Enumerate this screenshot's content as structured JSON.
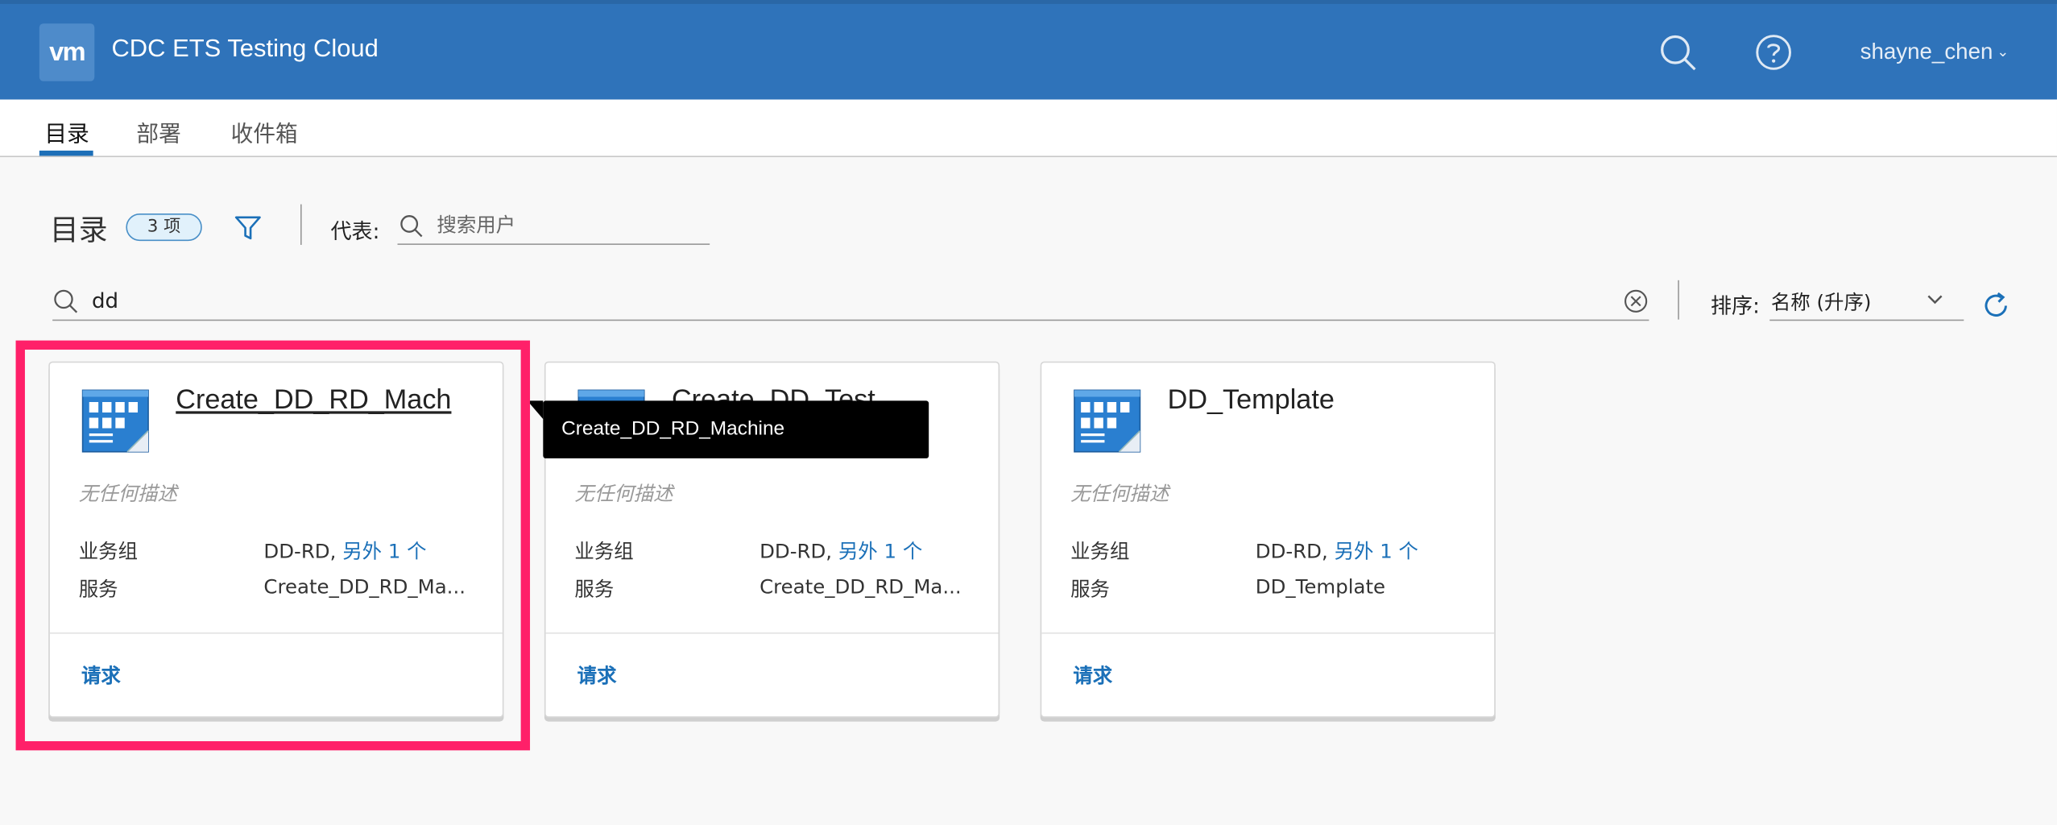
{
  "app": {
    "logo_text": "vm",
    "title": "CDC ETS Testing Cloud",
    "user": "shayne_chen",
    "brand_color": "#2f73ba",
    "accent_color": "#1b70b8",
    "highlight_color": "#ff2069"
  },
  "header_icons": [
    "search-icon",
    "help-icon"
  ],
  "nav": {
    "tabs": [
      {
        "label": "目录",
        "active": true
      },
      {
        "label": "部署",
        "active": false
      },
      {
        "label": "收件箱",
        "active": false
      }
    ]
  },
  "toolbar": {
    "title": "目录",
    "count_badge": "3 项",
    "on_behalf_label": "代表:",
    "user_search_placeholder": "搜索用户",
    "search_value": "dd",
    "sort_label": "排序:",
    "sort_value": "名称 (升序)"
  },
  "cards": [
    {
      "title": "Create_DD_RD_Mach",
      "description": "无任何描述",
      "business_group_label": "业务组",
      "business_group_value": "DD-RD,",
      "business_group_more": "另外 1 个",
      "service_label": "服务",
      "service_value": "Create_DD_RD_Ma...",
      "action": "请求"
    },
    {
      "title": "Create_DD_Test",
      "description": "无任何描述",
      "business_group_label": "业务组",
      "business_group_value": "DD-RD,",
      "business_group_more": "另外 1 个",
      "service_label": "服务",
      "service_value": "Create_DD_RD_Ma...",
      "action": "请求"
    },
    {
      "title": "DD_Template",
      "description": "无任何描述",
      "business_group_label": "业务组",
      "business_group_value": "DD-RD,",
      "business_group_more": "另外 1 个",
      "service_label": "服务",
      "service_value": "DD_Template",
      "action": "请求"
    }
  ],
  "tooltip": {
    "text": "Create_DD_RD_Machine"
  }
}
